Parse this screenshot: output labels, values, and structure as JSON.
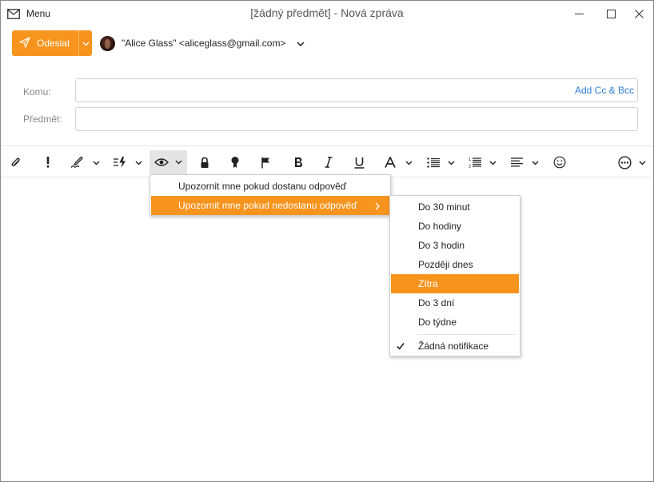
{
  "window": {
    "title": "[žádný předmět] - Nová zpráva",
    "menu_label": "Menu"
  },
  "send": {
    "label": "Odeslat"
  },
  "from": {
    "value": "\"Alice Glass\" <aliceglass@gmail.com>"
  },
  "fields": {
    "to_label": "Komu:",
    "to_value": "",
    "subject_label": "Předmět:",
    "subject_value": "",
    "add_cc_bcc": "Add Cc & Bcc"
  },
  "toolbar": {
    "icons": [
      "attachment-icon",
      "priority-icon",
      "signature-icon",
      "quick-text-icon",
      "read-receipt-icon",
      "lock-icon",
      "certificate-icon",
      "flag-icon",
      "bold-icon",
      "italic-icon",
      "underline-icon",
      "font-icon",
      "bullet-list-icon",
      "numbered-list-icon",
      "align-icon",
      "emoji-icon",
      "more-icon"
    ],
    "active": "read-receipt-icon"
  },
  "receipt_menu": {
    "items": [
      {
        "label": "Upozornit mne pokud dostanu odpověď",
        "highlighted": false
      },
      {
        "label": "Upozornit mne pokud nedostanu odpověď",
        "highlighted": true,
        "has_submenu": true
      }
    ]
  },
  "reminder_menu": {
    "items": [
      {
        "label": "Do 30 minut",
        "highlighted": false,
        "checked": false
      },
      {
        "label": "Do hodiny",
        "highlighted": false,
        "checked": false
      },
      {
        "label": "Do 3 hodin",
        "highlighted": false,
        "checked": false
      },
      {
        "label": "Později dnes",
        "highlighted": false,
        "checked": false
      },
      {
        "label": "Zítra",
        "highlighted": true,
        "checked": false
      },
      {
        "label": "Do 3 dní",
        "highlighted": false,
        "checked": false
      },
      {
        "label": "Do týdne",
        "highlighted": false,
        "checked": false
      },
      {
        "label": "Žádná notifikace",
        "highlighted": false,
        "checked": true
      }
    ]
  },
  "colors": {
    "accent": "#f7941d",
    "link": "#2a7bd4"
  }
}
